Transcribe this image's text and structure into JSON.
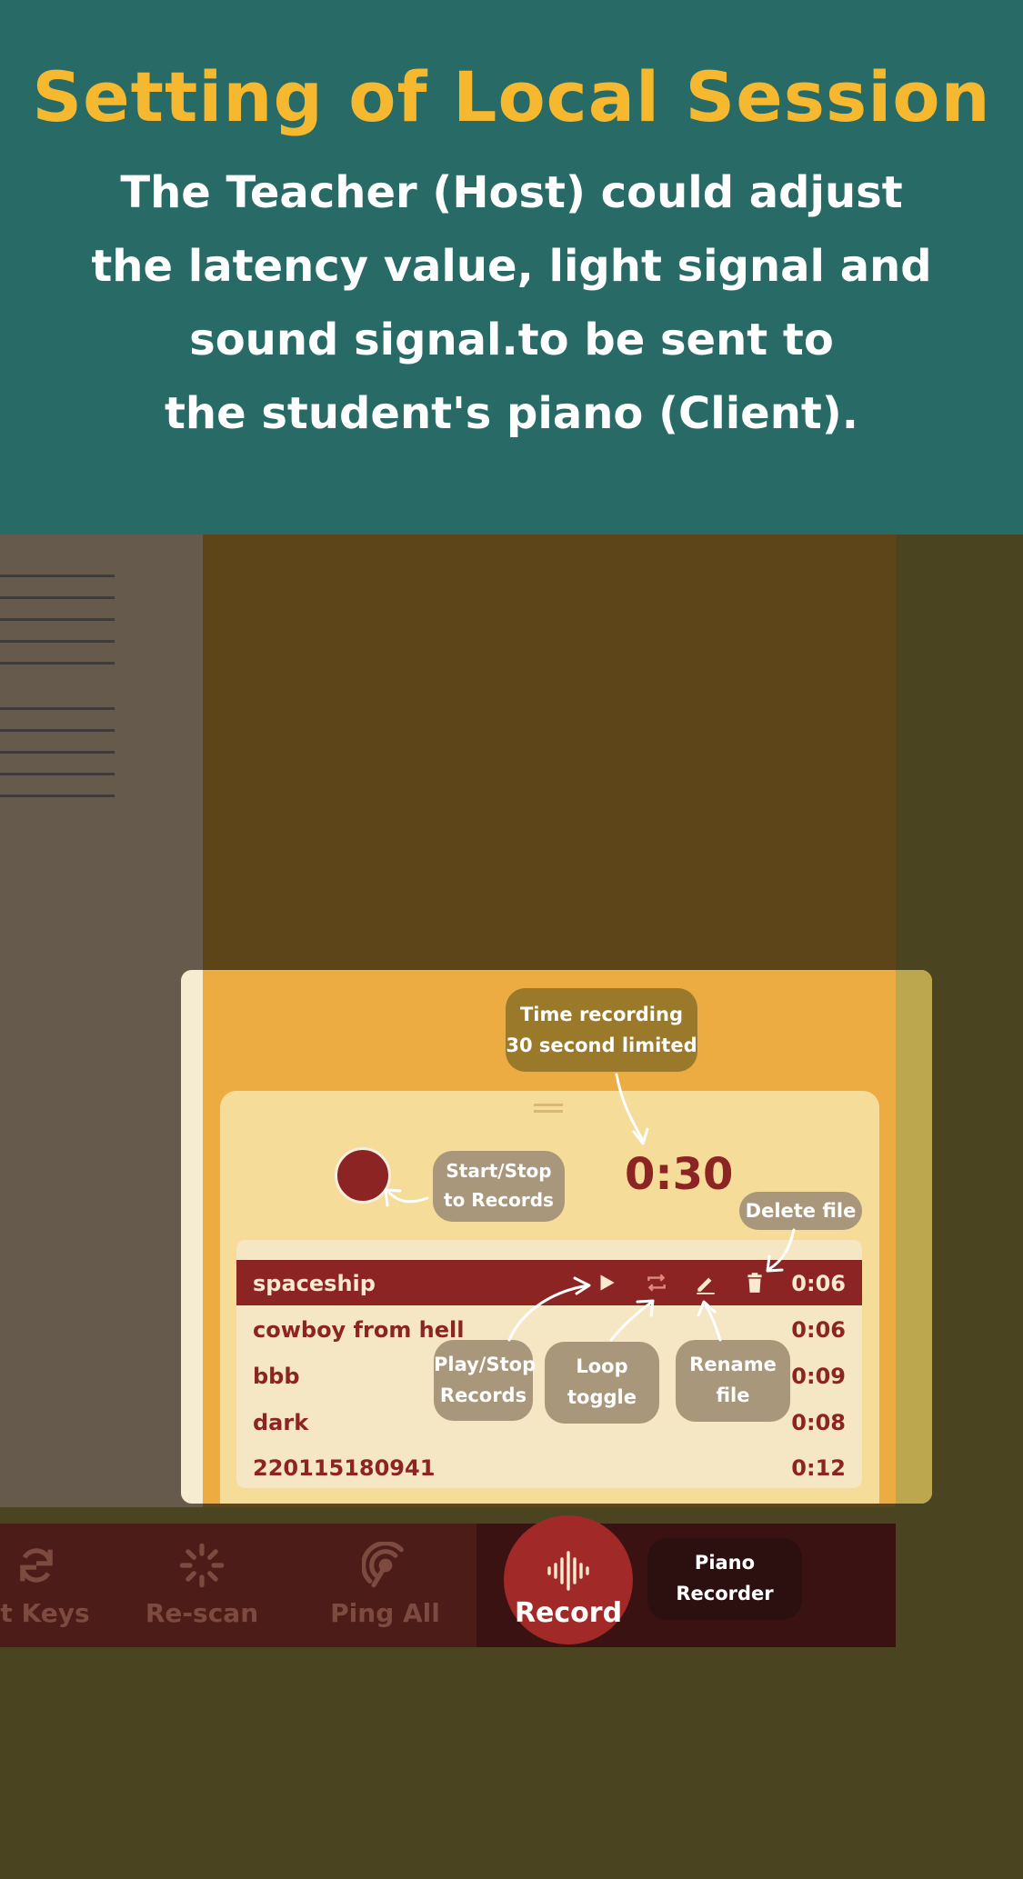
{
  "header": {
    "title": "Setting of Local Session",
    "description_lines": [
      "The Teacher (Host) could adjust",
      "the latency value, light signal and",
      "sound signal.to be sent to",
      "the student's piano (Client)."
    ]
  },
  "recorder": {
    "timer": "0:30",
    "records": [
      {
        "name": "spaceship",
        "duration": "0:06",
        "active": true
      },
      {
        "name": "cowboy from hell",
        "duration": "0:06",
        "active": false
      },
      {
        "name": "bbb",
        "duration": "0:09",
        "active": false
      },
      {
        "name": "dark",
        "duration": "0:08",
        "active": false
      },
      {
        "name": "220115180941",
        "duration": "0:12",
        "active": false
      }
    ],
    "controls": [
      "play-icon",
      "loop-icon",
      "pencil-icon",
      "trash-icon"
    ]
  },
  "callouts": {
    "time_recording": [
      "Time recording",
      "30 second limited"
    ],
    "start_stop": [
      "Start/Stop",
      "to Records"
    ],
    "delete_file": [
      "Delete file"
    ],
    "play_stop": [
      "Play/Stop",
      "Records"
    ],
    "loop_toggle": [
      "Loop",
      "toggle"
    ],
    "rename_file": [
      "Rename",
      "file"
    ],
    "piano_recorder": [
      "Piano",
      "Recorder"
    ]
  },
  "bottom_bar": {
    "items": [
      {
        "label": "et Keys",
        "icon": "refresh-icon"
      },
      {
        "label": "Re-scan",
        "icon": "spinner-icon"
      },
      {
        "label": "Ping All",
        "icon": "signal-icon"
      }
    ],
    "record": {
      "label": "Record",
      "icon": "waveform-icon"
    }
  },
  "colors": {
    "header_bg": "#276a66",
    "title": "#f5b82e",
    "accent_red": "#8c2424",
    "card": "#f5dc98"
  }
}
